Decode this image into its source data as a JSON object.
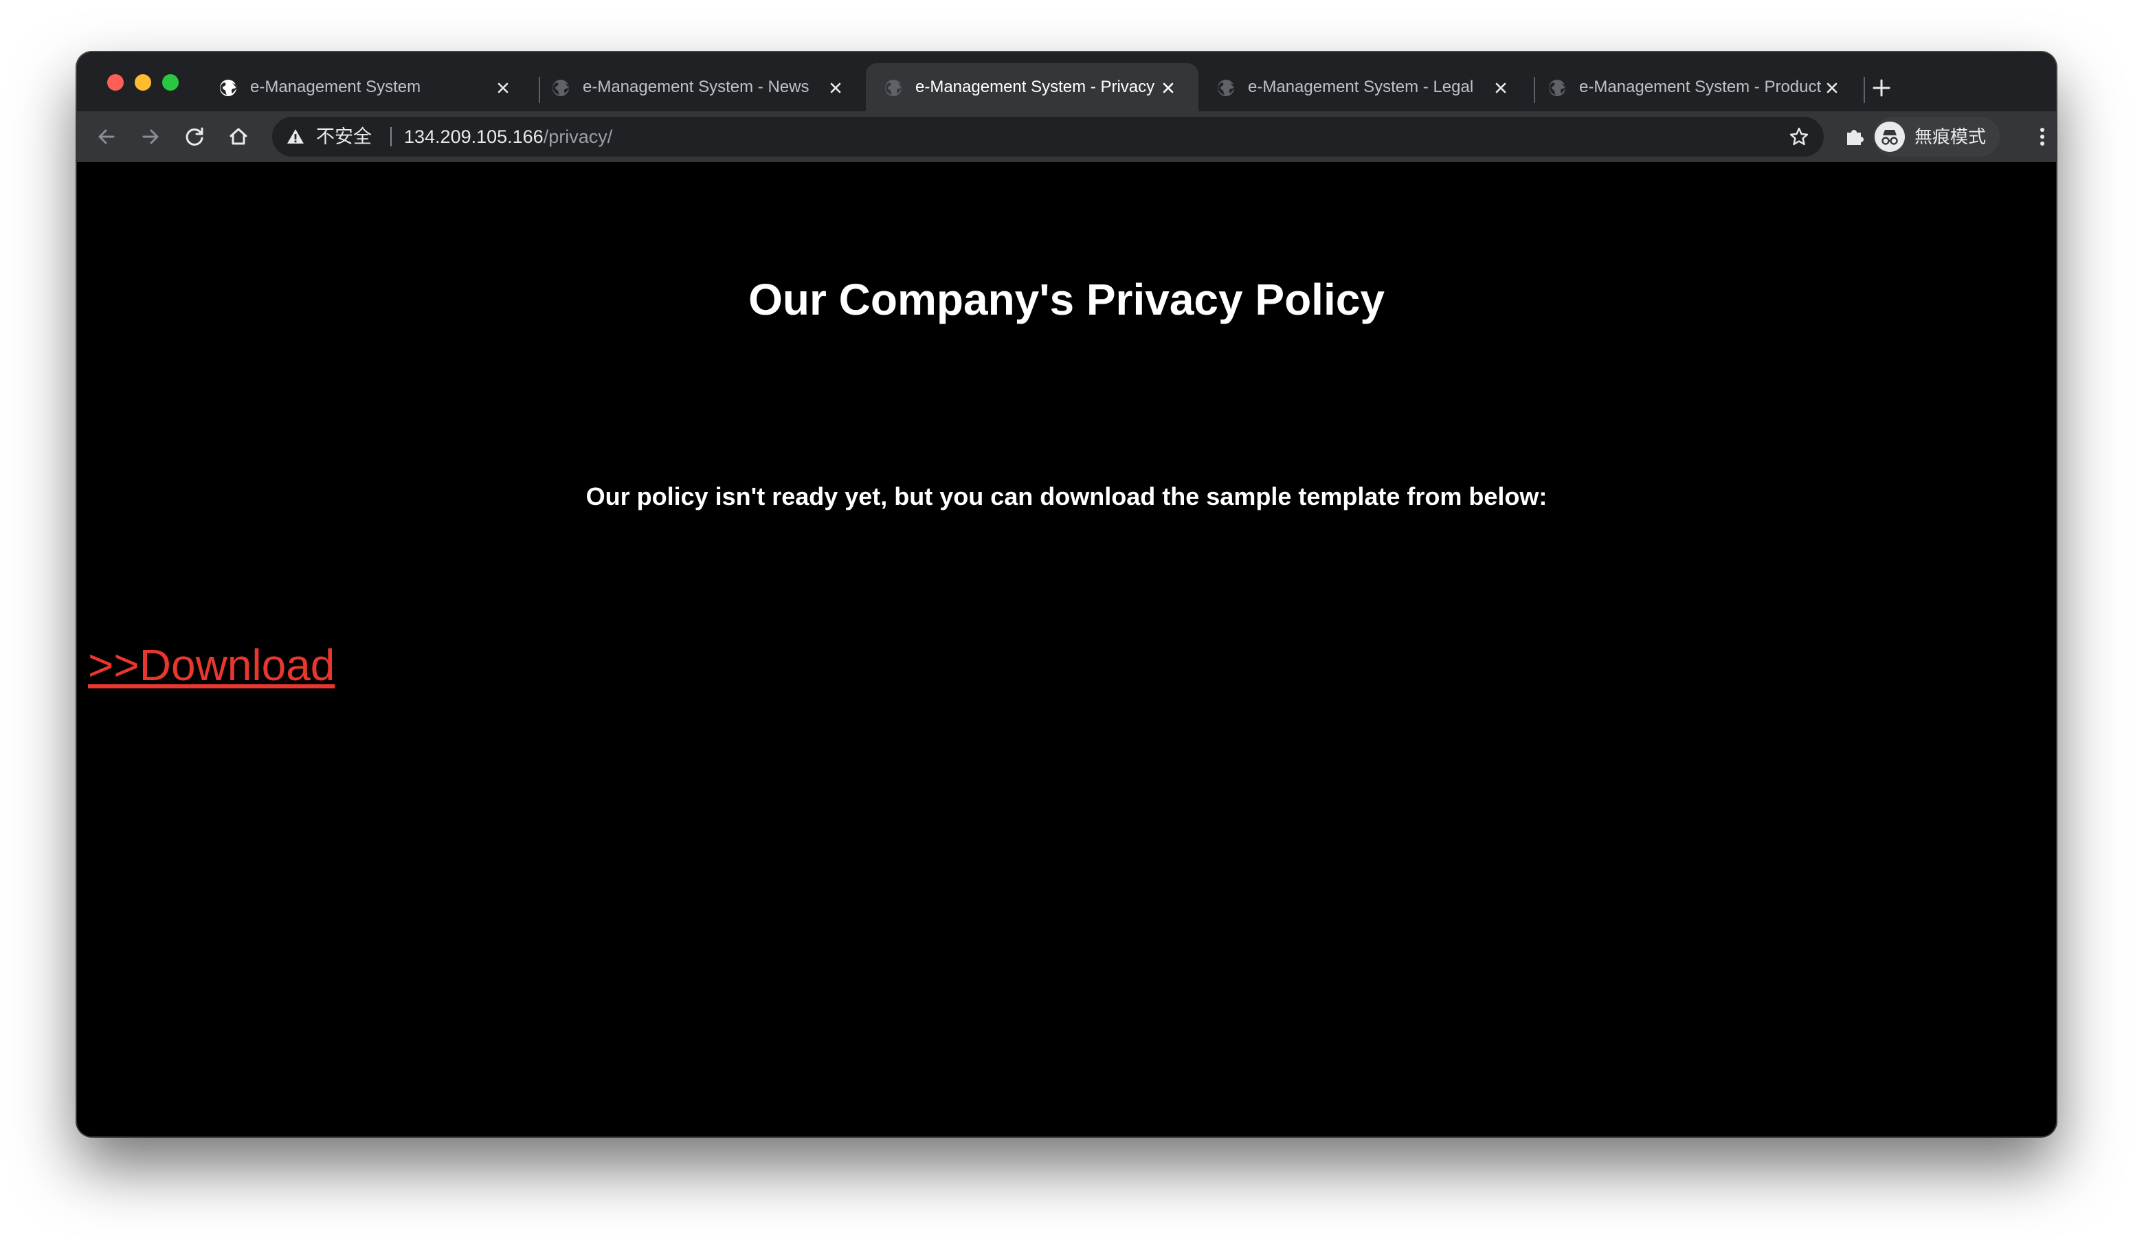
{
  "browser": {
    "tabs": [
      {
        "title": "e-Management System",
        "active": false
      },
      {
        "title": "e-Management System - News",
        "active": false
      },
      {
        "title": "e-Management System - Privacy",
        "active": true
      },
      {
        "title": "e-Management System - Legal",
        "active": false
      },
      {
        "title": "e-Management System - Products",
        "active": false
      }
    ],
    "address_bar": {
      "security_label": "不安全",
      "url_host": "134.209.105.166",
      "url_path": "/privacy/"
    },
    "profile_label": "無痕模式"
  },
  "page": {
    "title": "Our Company's Privacy Policy",
    "message": "Our policy isn't ready yet, but you can download the sample template from below:",
    "download_link": ">>Download"
  },
  "colors": {
    "page_background": "#000000",
    "text": "#ffffff",
    "link": "#e8372e",
    "tabstrip": "#202124",
    "toolbar": "#35363a"
  },
  "icons": [
    "globe-icon",
    "close-icon",
    "plus-icon",
    "back-icon",
    "forward-icon",
    "reload-icon",
    "home-icon",
    "warning-icon",
    "star-icon",
    "extensions-icon",
    "incognito-icon",
    "more-icon"
  ]
}
